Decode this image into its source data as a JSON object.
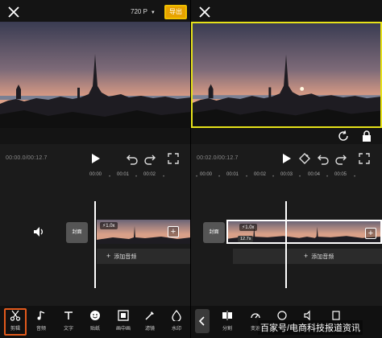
{
  "left": {
    "resolution": "720 P",
    "export_label": "导出",
    "timecode": "00:00.0/00:12.7",
    "ruler": {
      "t0": "00:00",
      "t1": "00:01",
      "t2": "00:02"
    },
    "cover_label": "封面",
    "speed": "1.0x",
    "add_audio_label": "添加音频",
    "tools": [
      {
        "label": "剪辑",
        "icon": "scissors-icon"
      },
      {
        "label": "音频",
        "icon": "music-note-icon"
      },
      {
        "label": "文字",
        "icon": "text-icon"
      },
      {
        "label": "贴纸",
        "icon": "sticker-icon"
      },
      {
        "label": "画中画",
        "icon": "picture-in-picture-icon"
      },
      {
        "label": "滤镜",
        "icon": "filter-icon"
      },
      {
        "label": "水印",
        "icon": "watermark-icon"
      }
    ]
  },
  "right": {
    "timecode": "00:02.0/00:12.7",
    "ruler": {
      "t0": "00:00",
      "t1": "00:01",
      "t2": "00:02",
      "t3": "00:03",
      "t4": "00:04",
      "t5": "00:05"
    },
    "cover_label": "封面",
    "speed": "1.0x",
    "duration": "12.7s",
    "add_audio_label": "添加音频",
    "tools": [
      {
        "label": "分割",
        "icon": "split-icon"
      },
      {
        "label": "变速",
        "icon": "speed-icon"
      }
    ]
  },
  "watermark": "百家号/电商科技报道资讯",
  "colors": {
    "accent": "#e8a300",
    "selection": "#e6e21a",
    "active_tool": "#e25a1c"
  }
}
